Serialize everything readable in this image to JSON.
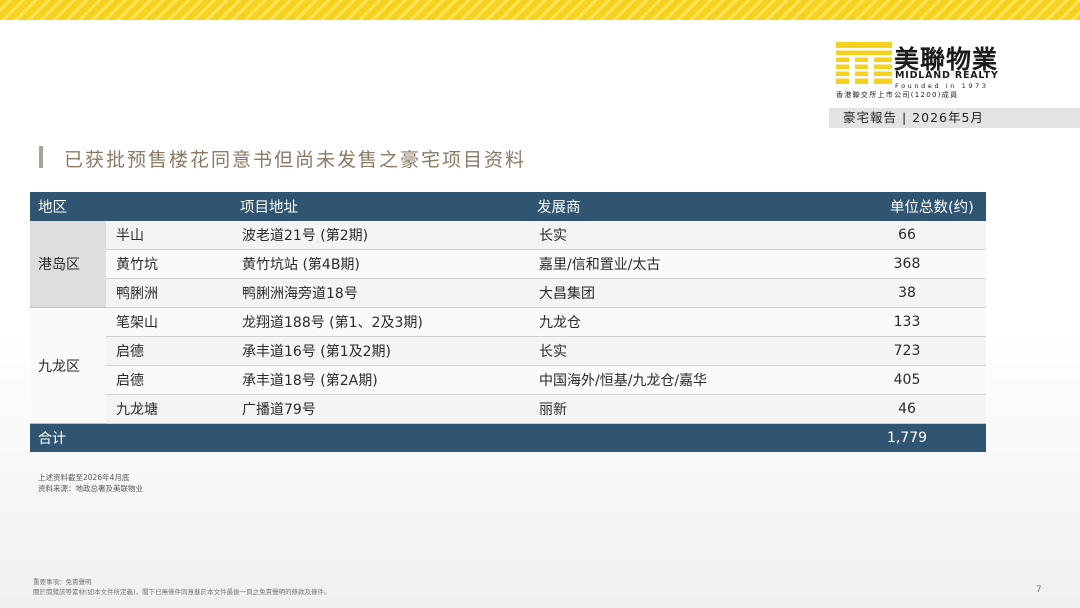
{
  "logo": {
    "cn": "美聯物業",
    "en": "MIDLAND REALTY",
    "founded": "Founded in 1973",
    "listed": "香港聯交所上市公司(1200)成員"
  },
  "report_label": "豪宅報告 | 2026年5月",
  "title": "已获批预售楼花同意书但尚未发售之豪宅项目资料",
  "table": {
    "headers": [
      "地区",
      "项目地址",
      "发展商",
      "单位总数(约)"
    ],
    "groups": [
      {
        "region": "港岛区",
        "rows": [
          {
            "district": "半山",
            "address": "波老道21号 (第2期)",
            "developer": "长实",
            "units": "66"
          },
          {
            "district": "黄竹坑",
            "address": "黄竹坑站 (第4B期)",
            "developer": "嘉里/信和置业/太古",
            "units": "368"
          },
          {
            "district": "鸭脷洲",
            "address": "鸭脷洲海旁道18号",
            "developer": "大昌集团",
            "units": "38"
          }
        ]
      },
      {
        "region": "九龙区",
        "rows": [
          {
            "district": "笔架山",
            "address": "龙翔道188号 (第1、2及3期)",
            "developer": "九龙仓",
            "units": "133"
          },
          {
            "district": "启德",
            "address": "承丰道16号 (第1及2期)",
            "developer": "长实",
            "units": "723"
          },
          {
            "district": "启德",
            "address": "承丰道18号 (第2A期)",
            "developer": "中国海外/恒基/九龙仓/嘉华",
            "units": "405"
          },
          {
            "district": "九龙塘",
            "address": "广播道79号",
            "developer": "丽新",
            "units": "46"
          }
        ]
      }
    ],
    "total_label": "合计",
    "total_units": "1,779"
  },
  "notes": [
    "上述资料截至2026年4月底",
    "资料来源：地政总署及美联物业"
  ],
  "disclaimer": [
    "重要事項：免責聲明",
    "關於閱覽該等素材(如本文件所定義)，閣下已無條件同意載於本文件最後一頁之免責聲明的條款及條件。"
  ],
  "page_number": "7",
  "colors": {
    "header_bg": "#2f5572",
    "accent_yellow": "#f7d21c",
    "title": "#8a7a63"
  }
}
